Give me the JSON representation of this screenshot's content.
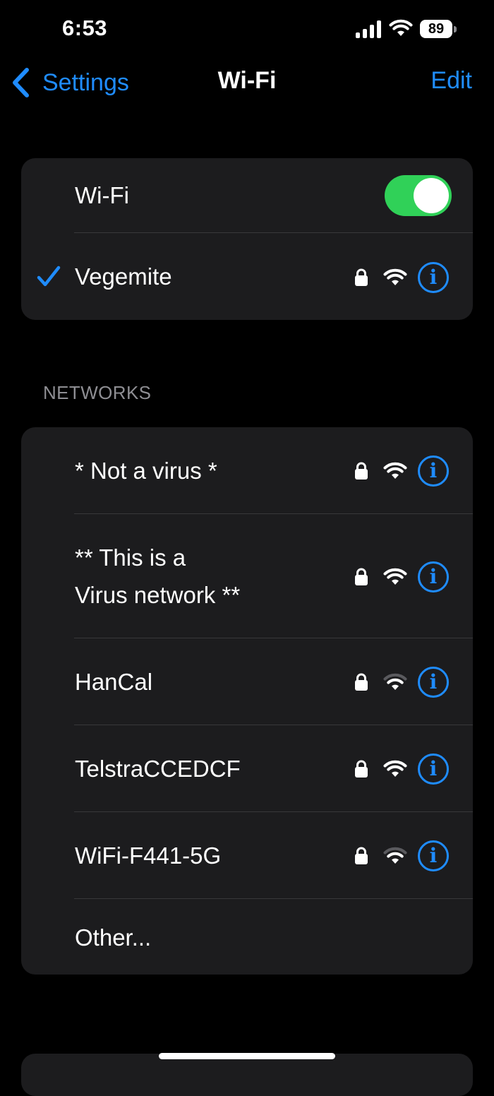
{
  "status_bar": {
    "time": "6:53",
    "battery_level": "89",
    "icons": [
      "signal-icon",
      "wifi-icon",
      "battery-icon"
    ]
  },
  "nav": {
    "back_label": "Settings",
    "title": "Wi-Fi",
    "edit_label": "Edit"
  },
  "wifi": {
    "toggle_label": "Wi-Fi",
    "toggle_on": true,
    "connected_network": "Vegemite"
  },
  "networks": {
    "header": "NETWORKS",
    "items": [
      {
        "name_line1": "* Not a virus *",
        "name_line2": "",
        "secured": true,
        "signal": "full"
      },
      {
        "name_line1": "** This is a",
        "name_line2": "Virus network **",
        "secured": true,
        "signal": "full"
      },
      {
        "name_line1": "HanCal",
        "name_line2": "",
        "secured": true,
        "signal": "weak"
      },
      {
        "name_line1": "TelstraCCEDCF",
        "name_line2": "",
        "secured": true,
        "signal": "full"
      },
      {
        "name_line1": "WiFi-F441-5G",
        "name_line2": "",
        "secured": true,
        "signal": "weak"
      }
    ],
    "other_label": "Other..."
  },
  "info_glyph": "i",
  "colors": {
    "accent": "#1f8cff",
    "toggle_on": "#30d158",
    "card_bg": "#1c1c1e",
    "background": "#000000",
    "separator": "#38383a",
    "secondary_text": "#8e8e93"
  }
}
